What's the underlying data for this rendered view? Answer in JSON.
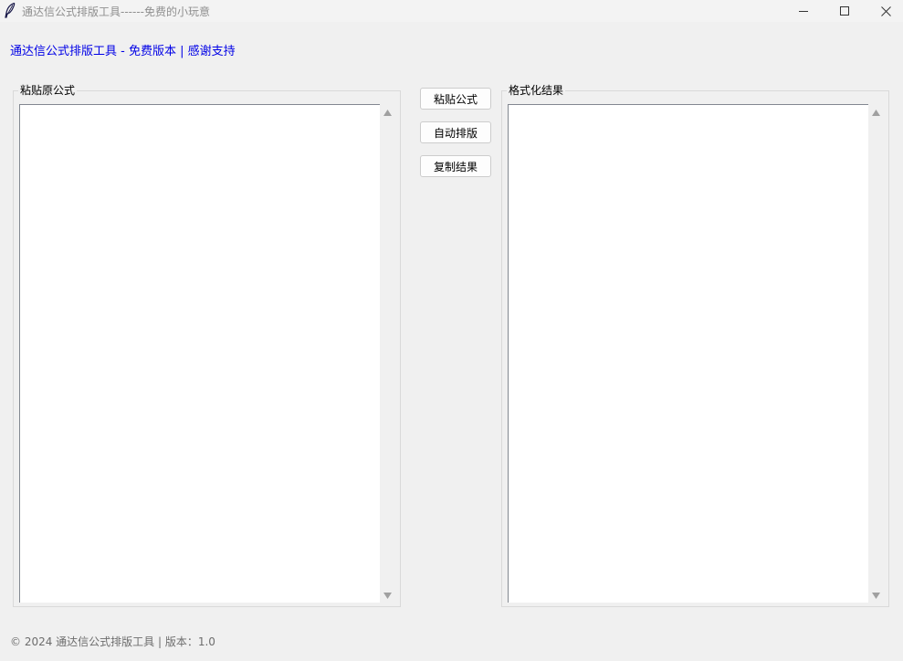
{
  "window": {
    "title": "通达信公式排版工具------免费的小玩意",
    "controls": {
      "minimize_icon": "minimize-icon",
      "maximize_icon": "maximize-icon",
      "close_icon": "close-icon"
    },
    "app_icon": "feather-icon"
  },
  "header": {
    "text": "通达信公式排版工具 - 免费版本 | 感谢支持",
    "color": "#0000e6"
  },
  "left_panel": {
    "title": "粘贴原公式",
    "content": ""
  },
  "right_panel": {
    "title": "格式化结果",
    "content": ""
  },
  "buttons": {
    "paste": "粘贴公式",
    "format": "自动排版",
    "copy": "复制结果"
  },
  "footer": {
    "text": "© 2024 通达信公式排版工具 | 版本：1.0"
  }
}
